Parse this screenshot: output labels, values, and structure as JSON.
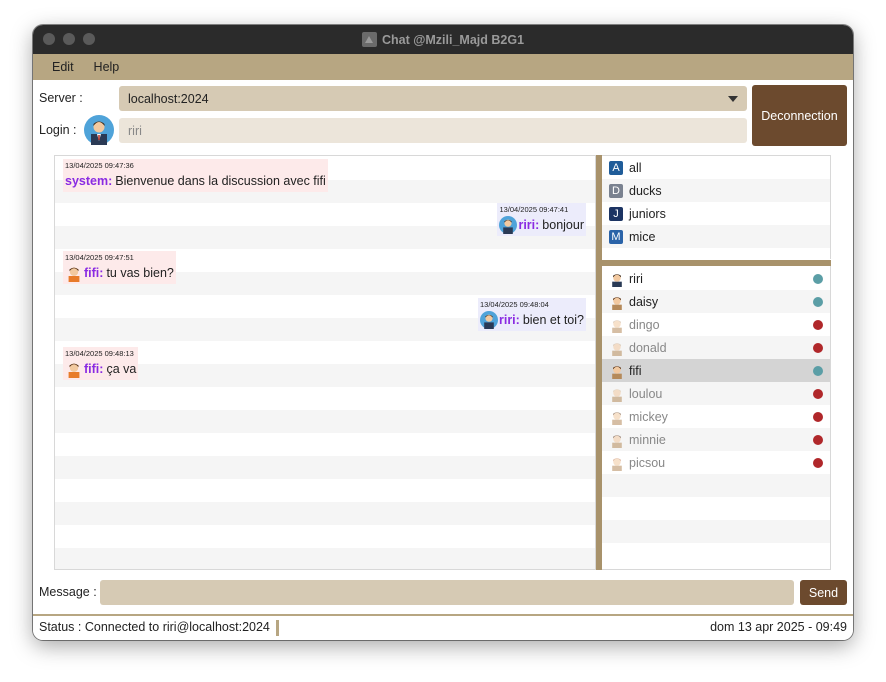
{
  "window": {
    "title": "Chat @Mzili_Majd B2G1"
  },
  "menu": [
    "Edit",
    "Help"
  ],
  "server": {
    "label": "Server :",
    "value": "localhost:2024"
  },
  "login": {
    "label": "Login :",
    "value": "riri"
  },
  "deconnect_label": "Deconnection",
  "messages": [
    {
      "side": "left",
      "timestamp": "13/04/2025 09:47:36",
      "author": "system:",
      "text": "Bienvenue dans la discussion avec fifi",
      "avatar": "none"
    },
    {
      "side": "right",
      "timestamp": "13/04/2025 09:47:41",
      "author": "riri:",
      "text": "bonjour",
      "avatar": "riri-avatar-icon"
    },
    {
      "side": "left",
      "timestamp": "13/04/2025 09:47:51",
      "author": "fifi:",
      "text": "tu vas bien?",
      "avatar": "fifi-avatar-icon"
    },
    {
      "side": "right",
      "timestamp": "13/04/2025 09:48:04",
      "author": "riri:",
      "text": "bien et toi?",
      "avatar": "riri-avatar-icon"
    },
    {
      "side": "left",
      "timestamp": "13/04/2025 09:48:13",
      "author": "fifi:",
      "text": "ça va",
      "avatar": "fifi-avatar-icon"
    }
  ],
  "groups": [
    {
      "badge": "A",
      "name": "all",
      "color": "#1f5c99"
    },
    {
      "badge": "D",
      "name": "ducks",
      "color": "#7a8290"
    },
    {
      "badge": "J",
      "name": "juniors",
      "color": "#1c3463"
    },
    {
      "badge": "M",
      "name": "mice",
      "color": "#2a63a8"
    }
  ],
  "users": [
    {
      "name": "riri",
      "status": "online",
      "active": true,
      "selected": false
    },
    {
      "name": "daisy",
      "status": "online",
      "active": true,
      "selected": false
    },
    {
      "name": "dingo",
      "status": "offline",
      "active": false,
      "selected": false
    },
    {
      "name": "donald",
      "status": "offline",
      "active": false,
      "selected": false
    },
    {
      "name": "fifi",
      "status": "online",
      "active": true,
      "selected": true
    },
    {
      "name": "loulou",
      "status": "offline",
      "active": false,
      "selected": false
    },
    {
      "name": "mickey",
      "status": "offline",
      "active": false,
      "selected": false
    },
    {
      "name": "minnie",
      "status": "offline",
      "active": false,
      "selected": false
    },
    {
      "name": "picsou",
      "status": "offline",
      "active": false,
      "selected": false
    }
  ],
  "colors": {
    "online": "#5b9ea6",
    "offline": "#b0272a",
    "accent": "#6c4a2e",
    "menubar": "#b7a682"
  },
  "message_input": {
    "label": "Message :",
    "value": ""
  },
  "send_label": "Send",
  "status": {
    "left": "Status :  Connected to riri@localhost:2024",
    "right": "dom 13 apr 2025 - 09:49"
  }
}
